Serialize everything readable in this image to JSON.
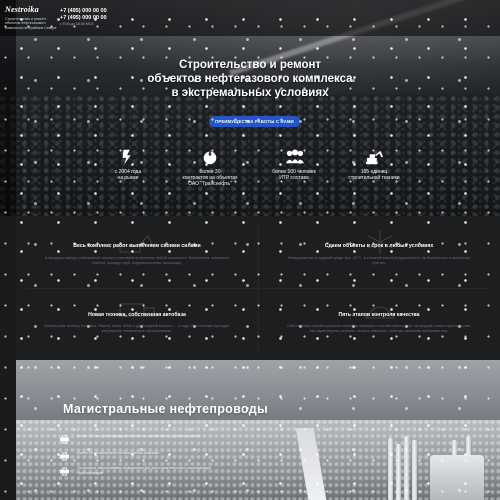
{
  "header": {
    "logo": "Nestroikа",
    "tagline": "Строительство и ремонт объектов нефтегазового комплекса на Крайнем Севере",
    "phone1": "+7 (495) 000 00 00",
    "phone2": "+7 (495) 000 00 00",
    "hours": "с 9:00 до 18:00 МСК"
  },
  "hero": {
    "title_line1": "Строительство и ремонт",
    "title_line2": "объектов нефтегазового комплекса",
    "title_line3": "в экстремальных условиях",
    "cta": "ПРЕИМУЩЕСТВА РАБОТЫ С НАМИ",
    "stats": [
      {
        "icon": "calendar-icon",
        "line1": "с 2004 года",
        "line2": "на рынке"
      },
      {
        "icon": "gas-drop-icon",
        "line1": "более 30",
        "line2": "контрактов на объектах",
        "line3": "ОАО \"Транснефть\""
      },
      {
        "icon": "team-icon",
        "line1": "более 100 человек",
        "line2": "ИТР состава"
      },
      {
        "icon": "excavator-icon",
        "line1": "165 единиц",
        "line2": "строительной техники"
      }
    ]
  },
  "features": [
    {
      "title": "Весь комплекс работ выполняем своими силами",
      "desc": "Благодаря набору собственной техники участвуем в проектах любой сложности. Выполняем: земляные работы, укладку труб, гидроиспытания, прокладку."
    },
    {
      "title": "Сдаем объекты в срок в любых условиях",
      "desc": "Незадолженно в трудной среде при -40°С, в сложной местной дорожности, на болотистых и скалистых грунтах."
    },
    {
      "title": "Новая техника, собственная автобаза",
      "desc": "Используем технику Komatsu, Hitachi, Volvo, MAN и др. Средний возраст — 4 года. Вся техника проходит регулярное техническое обслуживание."
    },
    {
      "title": "Пять этапов контроля качества",
      "desc": "Собственная служба контроля качества проверяет соответствие работ на каждом этапе строительства. Мы гарантируем качество на всех объектах, поэтому заказчики выбирают нас."
    }
  ],
  "pipeline": {
    "title": "Магистральные нефтепроводы",
    "items": [
      {
        "icon": "pipe-icon",
        "text": "Более 300 км трубопроводов построено и капитально отремонтировано"
      },
      {
        "icon": "pipe-icon",
        "text": "Более 50 км построено на болотистых участках"
      },
      {
        "icon": "pipe-icon",
        "text": "Полностью обеспечиваем инфраструктуру для строительства и эксплуатации трубопроводов"
      }
    ]
  },
  "colors": {
    "accent": "#2456c9",
    "dark": "#1d1e20",
    "muted": "#6a6d71"
  }
}
